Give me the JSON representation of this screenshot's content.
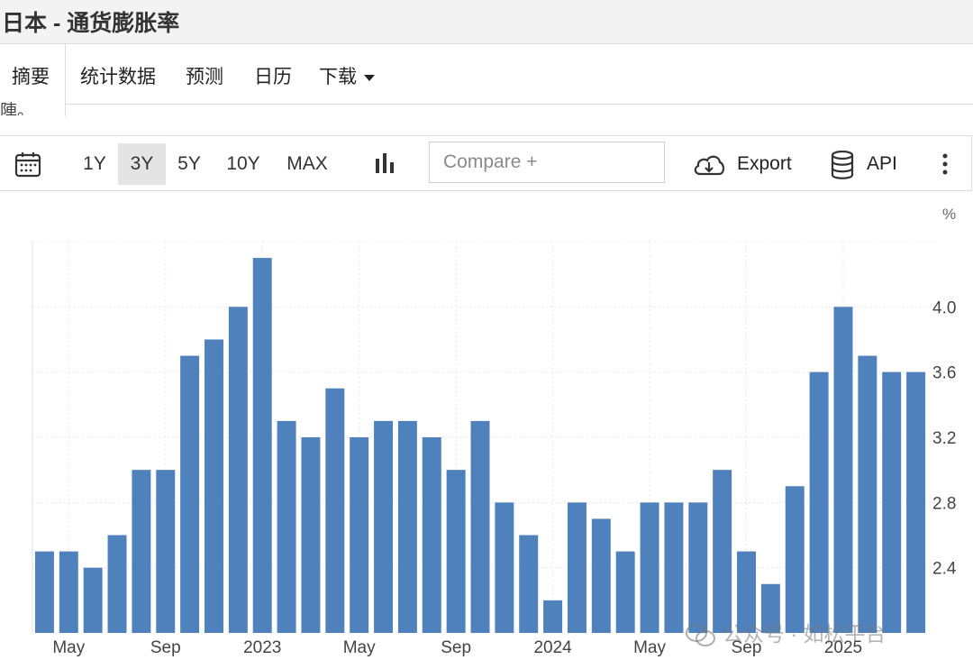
{
  "header": {
    "title": "日本 - 通货膨胀率"
  },
  "tabs": [
    {
      "label": "摘要"
    },
    {
      "label": "统计数据"
    },
    {
      "label": "预测"
    },
    {
      "label": "日历"
    },
    {
      "label": "下载"
    }
  ],
  "clipped_text": "陣。",
  "toolbar": {
    "ranges": [
      "1Y",
      "3Y",
      "5Y",
      "10Y",
      "MAX"
    ],
    "active_range": "3Y",
    "compare_placeholder": "Compare +",
    "export_label": "Export",
    "api_label": "API"
  },
  "chart_data": {
    "type": "bar",
    "unit_label": "%",
    "y_axis_side": "right",
    "ylim": [
      2.0,
      4.4
    ],
    "yticks": [
      2.4,
      2.8,
      3.2,
      3.6,
      4.0
    ],
    "bar_color": "#4f81bd",
    "grid": true,
    "values": [
      2.5,
      2.5,
      2.4,
      2.6,
      3.0,
      3.0,
      3.7,
      3.8,
      4.0,
      4.3,
      3.3,
      3.2,
      3.5,
      3.2,
      3.3,
      3.3,
      3.2,
      3.0,
      3.3,
      2.8,
      2.6,
      2.2,
      2.8,
      2.7,
      2.5,
      2.8,
      2.8,
      2.8,
      3.0,
      2.5,
      2.3,
      2.9,
      3.6,
      4.0,
      3.7,
      3.6,
      3.6
    ],
    "xticks": [
      {
        "index": 1,
        "label": "May"
      },
      {
        "index": 5,
        "label": "Sep"
      },
      {
        "index": 9,
        "label": "2023"
      },
      {
        "index": 13,
        "label": "May"
      },
      {
        "index": 17,
        "label": "Sep"
      },
      {
        "index": 21,
        "label": "2024"
      },
      {
        "index": 25,
        "label": "May"
      },
      {
        "index": 29,
        "label": "Sep"
      },
      {
        "index": 33,
        "label": "2025"
      }
    ]
  },
  "watermark": {
    "text": "公众号 · 如松平台",
    "icon": "wechat-icon"
  }
}
